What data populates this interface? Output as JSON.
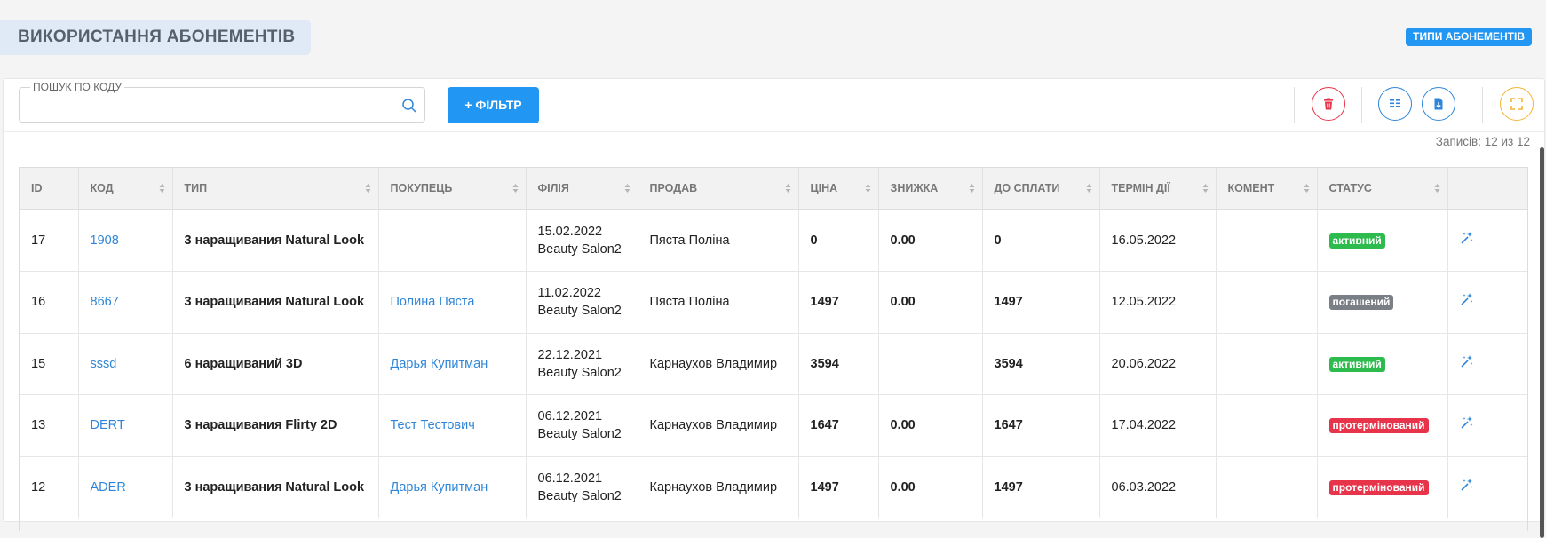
{
  "header": {
    "title": "ВИКОРИСТАННЯ АБОНЕМЕНТІВ",
    "types_button": "ТИПИ АБОНЕМЕНТІВ"
  },
  "toolbar": {
    "search_label": "ПОШУК ПО КОДУ",
    "search_value": "",
    "filter_button": "+ ФІЛЬТР",
    "icons": [
      "search-icon",
      "trash-icon",
      "columns-icon",
      "download-file-icon",
      "fullscreen-icon"
    ]
  },
  "records": "Записів: 12 из 12",
  "colors": {
    "primary": "#2196f3",
    "active": "#2cbb4c",
    "repaid": "#7a7f86",
    "expired": "#e8344a",
    "delete": "#e8344a",
    "fullscreen": "#f3b535"
  },
  "table": {
    "columns": [
      "ID",
      "КОД",
      "ТИП",
      "ПОКУПЕЦЬ",
      "ФІЛІЯ",
      "ПРОДАВ",
      "ЦІНА",
      "ЗНИЖКА",
      "ДО СПЛАТИ",
      "ТЕРМІН ДІЇ",
      "КОМЕНТ",
      "СТАТУС",
      ""
    ],
    "rows": [
      {
        "id": "17",
        "code": "1908",
        "type": "3 наращивания Natural Look",
        "buyer": "",
        "date": "15.02.2022",
        "branch": "Beauty Salon2",
        "seller": "Пяста Поліна",
        "price": "0",
        "discount": "0.00",
        "to_pay": "0",
        "term": "16.05.2022",
        "comment": "",
        "status": "активний",
        "status_kind": "active"
      },
      {
        "id": "16",
        "code": "8667",
        "type": "3 наращивания Natural Look",
        "buyer": "Полина Пяста",
        "date": "11.02.2022",
        "branch": "Beauty Salon2",
        "seller": "Пяста Поліна",
        "price": "1497",
        "discount": "0.00",
        "to_pay": "1497",
        "term": "12.05.2022",
        "comment": "",
        "status": "погашений",
        "status_kind": "repaid"
      },
      {
        "id": "15",
        "code": "sssd",
        "type": "6 наращиваний 3D",
        "buyer": "Дарья Купитман",
        "date": "22.12.2021",
        "branch": "Beauty Salon2",
        "seller": "Карнаухов Владимир",
        "price": "3594",
        "discount": "",
        "to_pay": "3594",
        "term": "20.06.2022",
        "comment": "",
        "status": "активний",
        "status_kind": "active"
      },
      {
        "id": "13",
        "code": "DERT",
        "type": "3 наращивания Flirty 2D",
        "buyer": "Тест Тестович",
        "date": "06.12.2021",
        "branch": "Beauty Salon2",
        "seller": "Карнаухов Владимир",
        "price": "1647",
        "discount": "0.00",
        "to_pay": "1647",
        "term": "17.04.2022",
        "comment": "",
        "status": "протермінований",
        "status_kind": "expired"
      },
      {
        "id": "12",
        "code": "ADER",
        "type": "3 наращивания Natural Look",
        "buyer": "Дарья Купитман",
        "date": "06.12.2021",
        "branch": "Beauty Salon2",
        "seller": "Карнаухов Владимир",
        "price": "1497",
        "discount": "0.00",
        "to_pay": "1497",
        "term": "06.03.2022",
        "comment": "",
        "status": "протермінований",
        "status_kind": "expired"
      }
    ]
  }
}
